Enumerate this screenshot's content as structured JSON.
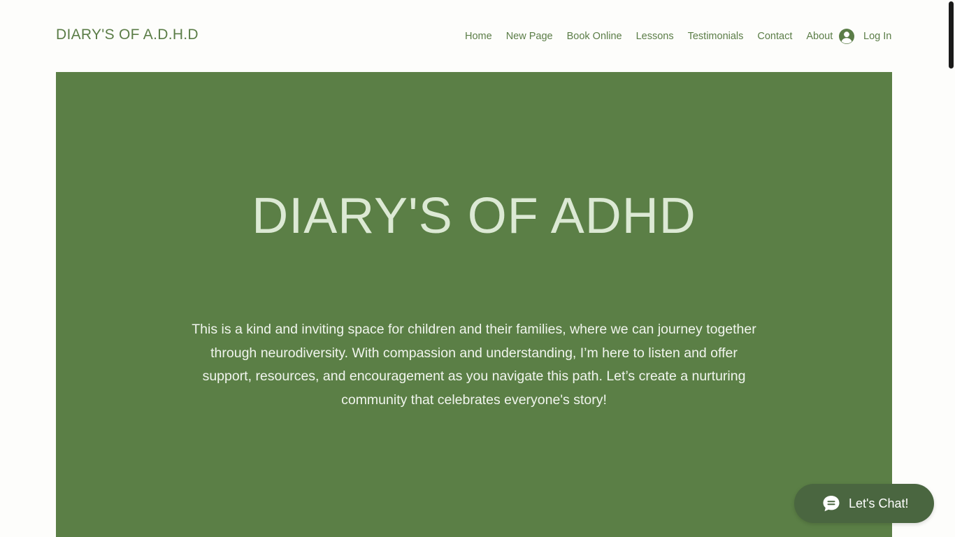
{
  "header": {
    "site_title": "DIARY'S OF A.D.H.D",
    "nav": [
      {
        "label": "Home"
      },
      {
        "label": "New Page"
      },
      {
        "label": "Book Online"
      },
      {
        "label": "Lessons"
      },
      {
        "label": "Testimonials"
      },
      {
        "label": "Contact"
      },
      {
        "label": "About"
      }
    ],
    "login": {
      "label": "Log In",
      "icon": "user-circle-icon"
    }
  },
  "hero": {
    "title": "DIARY'S OF ADHD",
    "text": "This is a kind and inviting space for children and their families, where we can journey together through neurodiversity. With compassion and understanding, I’m here to listen and offer support, resources, and encouragement as you navigate this path. Let’s create a nurturing community that celebrates everyone's story!",
    "background_color": "#5b7f46"
  },
  "chat": {
    "label": "Let's Chat!",
    "icon": "chat-bubble-icon",
    "color": "#4a6640"
  },
  "colors": {
    "accent": "#5b7d47",
    "hero_title": "#dce9d4"
  }
}
